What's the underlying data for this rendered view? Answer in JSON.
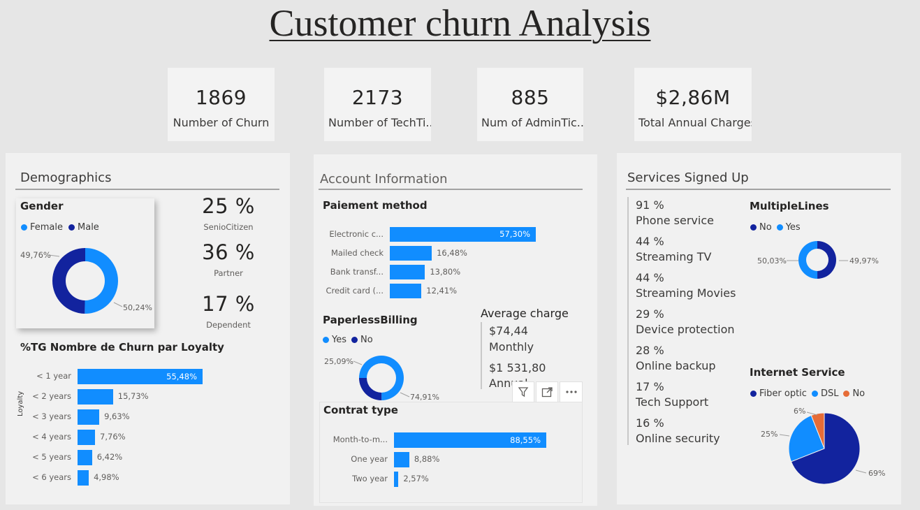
{
  "title": "Customer churn Analysis",
  "kpis": [
    {
      "value": "1869",
      "label": "Number of Churn"
    },
    {
      "value": "2173",
      "label": "Number of TechTi..."
    },
    {
      "value": "885",
      "label": "Num of AdminTic..."
    },
    {
      "value": "$2,86M",
      "label": "Total Annual Charges"
    }
  ],
  "colors": {
    "blue": "#118dff",
    "navy": "#12239e",
    "orange": "#e66c37"
  },
  "demographics": {
    "title": "Demographics",
    "gender": {
      "title": "Gender",
      "legend": [
        "Female",
        "Male"
      ],
      "female_label": "50,24%",
      "male_label": "49,76%"
    },
    "stats": [
      {
        "value": "25 %",
        "label": "SenioCitizen"
      },
      {
        "value": "36 %",
        "label": "Partner"
      },
      {
        "value": "17 %",
        "label": "Dependent"
      }
    ],
    "loyalty_title": "%TG Nombre de Churn par Loyalty",
    "loyalty_axis": "Loyalty"
  },
  "account": {
    "title": "Account Information",
    "payment_title": "Paiement method",
    "paperless": {
      "title": "PaperlessBilling",
      "legend": [
        "Yes",
        "No"
      ],
      "yes_label": "74,91%",
      "no_label": "25,09%"
    },
    "avg_charge": {
      "title": "Average charge",
      "monthly_value": "$74,44",
      "monthly_label": "Monthly",
      "annual_value": "$1 531,80",
      "annual_label": "Annual"
    },
    "contract_title": "Contrat type"
  },
  "services": {
    "title": "Services Signed Up",
    "items": [
      {
        "pct": "91 %",
        "label": "Phone service"
      },
      {
        "pct": "44 %",
        "label": "Streaming TV"
      },
      {
        "pct": "44 %",
        "label": "Streaming Movies"
      },
      {
        "pct": "29 %",
        "label": "Device protection"
      },
      {
        "pct": "28 %",
        "label": "Online backup"
      },
      {
        "pct": "17 %",
        "label": "Tech Support"
      },
      {
        "pct": "16 %",
        "label": "Online security"
      }
    ],
    "multiplelines": {
      "title": "MultipleLines",
      "legend": [
        "No",
        "Yes"
      ],
      "no_label": "49,97%",
      "yes_label": "50,03%"
    },
    "internet": {
      "title": "Internet Service",
      "legend": [
        "Fiber optic",
        "DSL",
        "No"
      ]
    }
  },
  "chart_data": [
    {
      "type": "bar",
      "title": "%TG Nombre de Churn par Loyalty",
      "ylabel": "Loyalty",
      "categories": [
        "< 1 year",
        "< 2 years",
        "< 3 years",
        "< 4 years",
        "< 5 years",
        "< 6 years"
      ],
      "values": [
        55.48,
        15.73,
        9.63,
        7.76,
        6.42,
        4.98
      ],
      "labels": [
        "55,48%",
        "15,73%",
        "9,63%",
        "7,76%",
        "6,42%",
        "4,98%"
      ]
    },
    {
      "type": "bar",
      "title": "Paiement method",
      "categories": [
        "Electronic c...",
        "Mailed check",
        "Bank transf...",
        "Credit card (..."
      ],
      "values": [
        57.3,
        16.48,
        13.8,
        12.41
      ],
      "labels": [
        "57,30%",
        "16,48%",
        "13,80%",
        "12,41%"
      ]
    },
    {
      "type": "bar",
      "title": "Contrat type",
      "categories": [
        "Month-to-m...",
        "One year",
        "Two year"
      ],
      "values": [
        88.55,
        8.88,
        2.57
      ],
      "labels": [
        "88,55%",
        "8,88%",
        "2,57%"
      ]
    },
    {
      "type": "pie",
      "title": "Gender",
      "categories": [
        "Female",
        "Male"
      ],
      "values": [
        50.24,
        49.76
      ]
    },
    {
      "type": "pie",
      "title": "PaperlessBilling",
      "categories": [
        "Yes",
        "No"
      ],
      "values": [
        74.91,
        25.09
      ]
    },
    {
      "type": "pie",
      "title": "MultipleLines",
      "categories": [
        "No",
        "Yes"
      ],
      "values": [
        49.97,
        50.03
      ]
    },
    {
      "type": "pie",
      "title": "Internet Service",
      "categories": [
        "Fiber optic",
        "DSL",
        "No"
      ],
      "values": [
        69,
        25,
        6
      ],
      "labels": [
        "69%",
        "25%",
        "6%"
      ]
    }
  ]
}
